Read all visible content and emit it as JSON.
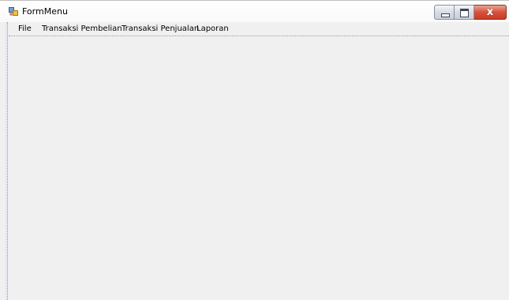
{
  "window": {
    "title": "FormMenu",
    "icon": "form-app-icon",
    "controls": {
      "minimize": "minimize-icon",
      "maximize": "maximize-icon",
      "close": "close-icon",
      "close_glyph": "x"
    }
  },
  "menu": {
    "items": [
      {
        "label": "File"
      },
      {
        "label": "Transaksi Pembelian"
      },
      {
        "label": "Transaksi Penjualan"
      },
      {
        "label": "Laporan"
      }
    ]
  },
  "colors": {
    "client_background": "#f0f0f0",
    "close_button": "#c63c23"
  }
}
